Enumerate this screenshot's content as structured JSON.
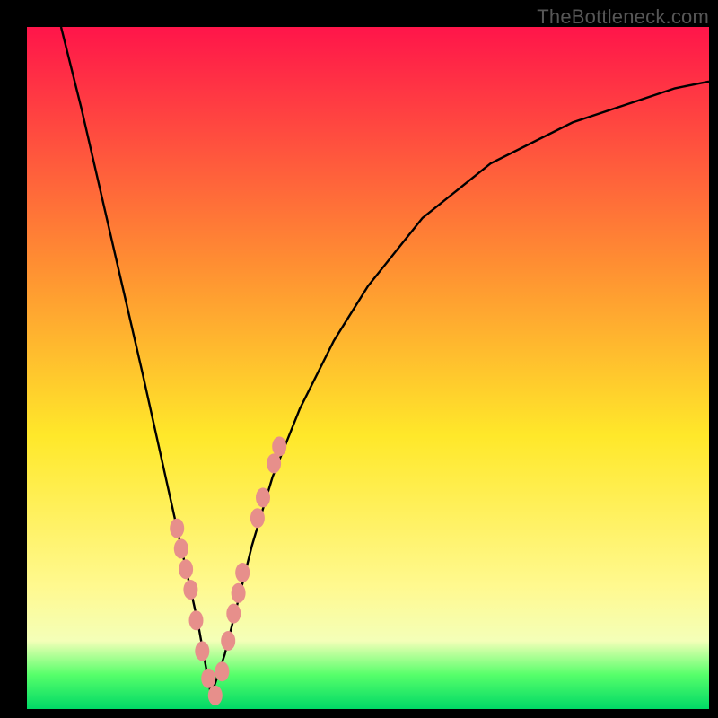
{
  "watermark": "TheBottleneck.com",
  "colors": {
    "black": "#000000",
    "curve": "#000000",
    "marker_fill": "#e78f8b",
    "gradient_top": "#ff154a",
    "gradient_mid_upper": "#ff8f32",
    "gradient_mid": "#ffe82a",
    "gradient_mid_lower": "#fff98f",
    "gradient_green_band_top": "#f4ffb8",
    "gradient_green_band": "#56ff6a",
    "gradient_bottom": "#00d966"
  },
  "chart_data": {
    "type": "line",
    "title": "",
    "xlabel": "",
    "ylabel": "",
    "xlim": [
      0,
      100
    ],
    "ylim": [
      0,
      100
    ],
    "curve_minimum_x": 27,
    "series": [
      {
        "name": "bottleneck-curve",
        "x": [
          5,
          8,
          11,
          14,
          17,
          19,
          21,
          23,
          25,
          27,
          29,
          31,
          33,
          36,
          40,
          45,
          50,
          58,
          68,
          80,
          95,
          100
        ],
        "y": [
          100,
          88,
          75,
          62,
          49,
          40,
          31,
          22,
          13,
          2,
          8,
          16,
          24,
          34,
          44,
          54,
          62,
          72,
          80,
          86,
          91,
          92
        ]
      }
    ],
    "markers": {
      "name": "highlighted-points",
      "x": [
        22.0,
        22.6,
        23.3,
        24.0,
        24.8,
        25.7,
        26.6,
        27.6,
        28.6,
        29.5,
        30.3,
        31.0,
        31.6,
        33.8,
        34.6,
        36.2,
        37.0
      ],
      "y": [
        26.5,
        23.5,
        20.5,
        17.5,
        13.0,
        8.5,
        4.5,
        2.0,
        5.5,
        10.0,
        14.0,
        17.0,
        20.0,
        28.0,
        31.0,
        36.0,
        38.5
      ]
    }
  }
}
